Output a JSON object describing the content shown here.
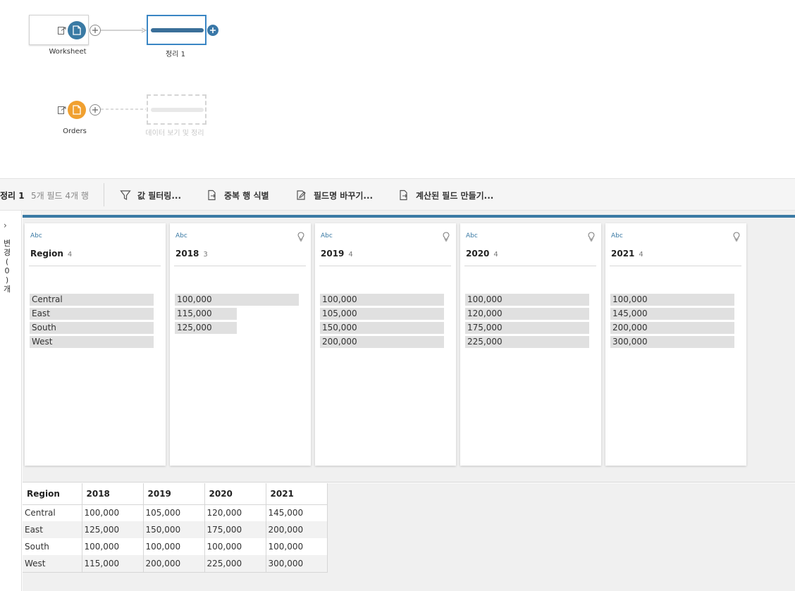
{
  "flow": {
    "input1_label": "Worksheet",
    "input2_label": "Orders",
    "clean_label": "정리 1",
    "ghost_label": "데이터 보기 및 정리"
  },
  "toolbar": {
    "title": "정리 1",
    "meta": "5개 필드  4개 행",
    "filter_label": "값 필터링...",
    "duplicates_label": "중복 행 식별",
    "rename_label": "필드명 바꾸기...",
    "calc_label": "계산된 필드 만들기..."
  },
  "side": {
    "chevron": "›",
    "chars": [
      "변",
      "경",
      "(",
      "0",
      ")",
      "개"
    ]
  },
  "colors": {
    "accent": "#3a7aa4",
    "input1_circle": "#3a7aa4",
    "input2_circle": "#f0a030"
  },
  "profile": {
    "cards": [
      {
        "type": "Abc",
        "name": "Region",
        "count": "4",
        "has_bulb": false,
        "bars": [
          {
            "label": "Central",
            "fraction": 1.0
          },
          {
            "label": "East",
            "fraction": 1.0
          },
          {
            "label": "South",
            "fraction": 1.0
          },
          {
            "label": "West",
            "fraction": 1.0
          }
        ]
      },
      {
        "type": "Abc",
        "name": "2018",
        "count": "3",
        "has_bulb": true,
        "bars": [
          {
            "label": "100,000",
            "fraction": 1.0
          },
          {
            "label": "115,000",
            "fraction": 0.5
          },
          {
            "label": "125,000",
            "fraction": 0.5
          }
        ]
      },
      {
        "type": "Abc",
        "name": "2019",
        "count": "4",
        "has_bulb": true,
        "bars": [
          {
            "label": "100,000",
            "fraction": 1.0
          },
          {
            "label": "105,000",
            "fraction": 1.0
          },
          {
            "label": "150,000",
            "fraction": 1.0
          },
          {
            "label": "200,000",
            "fraction": 1.0
          }
        ]
      },
      {
        "type": "Abc",
        "name": "2020",
        "count": "4",
        "has_bulb": true,
        "bars": [
          {
            "label": "100,000",
            "fraction": 1.0
          },
          {
            "label": "120,000",
            "fraction": 1.0
          },
          {
            "label": "175,000",
            "fraction": 1.0
          },
          {
            "label": "225,000",
            "fraction": 1.0
          }
        ]
      },
      {
        "type": "Abc",
        "name": "2021",
        "count": "4",
        "has_bulb": true,
        "bars": [
          {
            "label": "100,000",
            "fraction": 1.0
          },
          {
            "label": "145,000",
            "fraction": 1.0
          },
          {
            "label": "200,000",
            "fraction": 1.0
          },
          {
            "label": "300,000",
            "fraction": 1.0
          }
        ]
      }
    ]
  },
  "grid": {
    "headers": [
      "Region",
      "2018",
      "2019",
      "2020",
      "2021"
    ],
    "rows": [
      [
        "Central",
        "100,000",
        "105,000",
        "120,000",
        "145,000"
      ],
      [
        "East",
        "125,000",
        "150,000",
        "175,000",
        "200,000"
      ],
      [
        "South",
        "100,000",
        "100,000",
        "100,000",
        "100,000"
      ],
      [
        "West",
        "115,000",
        "200,000",
        "225,000",
        "300,000"
      ]
    ]
  }
}
